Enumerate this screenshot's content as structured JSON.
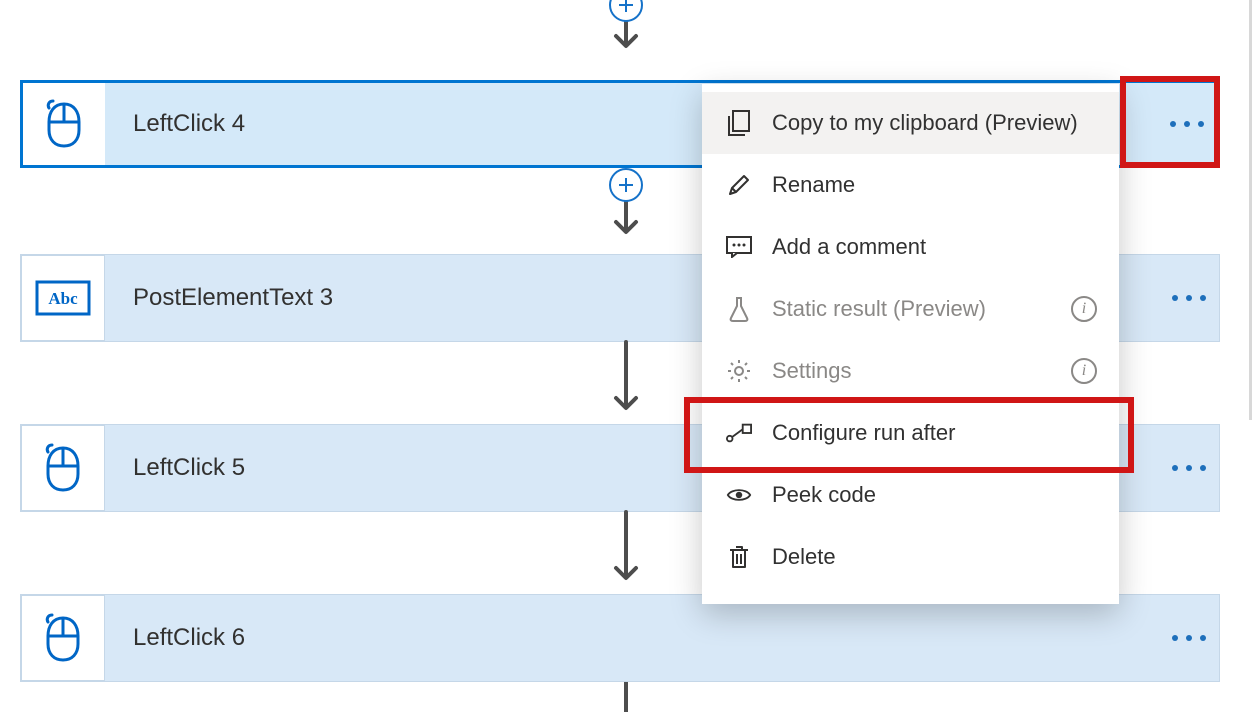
{
  "cards": [
    {
      "title": "LeftClick 4",
      "icon": "mouse"
    },
    {
      "title": "PostElementText 3",
      "icon": "abc"
    },
    {
      "title": "LeftClick 5",
      "icon": "mouse"
    },
    {
      "title": "LeftClick 6",
      "icon": "mouse"
    }
  ],
  "menu": {
    "copy": "Copy to my clipboard (Preview)",
    "rename": "Rename",
    "comment": "Add a comment",
    "static": "Static result (Preview)",
    "settings": "Settings",
    "runafter": "Configure run after",
    "peek": "Peek code",
    "delete": "Delete"
  },
  "colors": {
    "accent": "#0075d1",
    "highlight": "#d01616"
  }
}
